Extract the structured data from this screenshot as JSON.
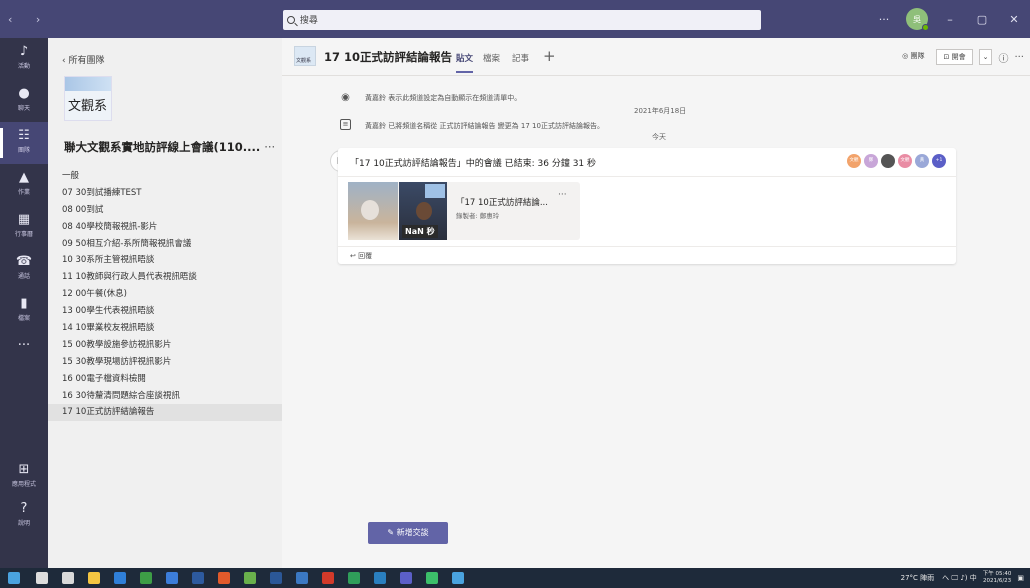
{
  "titlebar": {
    "search_placeholder": "搜尋",
    "more": "···",
    "avatar_initials": "吳"
  },
  "rail": [
    {
      "label": "活動",
      "icon": "bell-icon",
      "glyph": "♪"
    },
    {
      "label": "聊天",
      "icon": "chat-icon",
      "glyph": "●"
    },
    {
      "label": "團隊",
      "icon": "teams-icon",
      "glyph": "☷"
    },
    {
      "label": "作業",
      "icon": "assignments-icon",
      "glyph": "▲"
    },
    {
      "label": "行事曆",
      "icon": "calendar-icon",
      "glyph": "▦"
    },
    {
      "label": "通話",
      "icon": "phone-icon",
      "glyph": "☎"
    },
    {
      "label": "檔案",
      "icon": "files-icon",
      "glyph": "▮"
    },
    {
      "label": "",
      "icon": "more-icon",
      "glyph": "···"
    }
  ],
  "rail_bottom": [
    {
      "label": "應用程式",
      "icon": "apps-icon",
      "glyph": "⊞"
    },
    {
      "label": "說明",
      "icon": "help-icon",
      "glyph": "?"
    }
  ],
  "pane": {
    "back_label": "所有團隊",
    "team_logo_text": "文觀系",
    "team_name": "聯大文觀系實地訪評線上會議(110....",
    "team_more": "···",
    "channels": [
      "一般",
      "07 30到試播練TEST",
      "08 00到試",
      "08 40學校簡報視訊-影片",
      "09 50相互介紹-系所簡報視訊會議",
      "10 30系所主管視訊晤談",
      "11 10教師與行政人員代表視訊晤談",
      "12 00午餐(休息)",
      "13 00學生代表視訊晤談",
      "14 10畢業校友視訊晤談",
      "15 00教學設施參訪視訊影片",
      "15 30教學現場訪評視訊影片",
      "16 00電子檔資料檢閱",
      "16 30待釐清問題綜合座談視訊",
      "17 10正式訪評結論報告"
    ],
    "active_channel": 14
  },
  "main": {
    "channel_icon_text": "文觀系",
    "channel_title": "17 10正式訪評結論報告",
    "tabs": [
      "貼文",
      "檔案",
      "記事"
    ],
    "tab_add": "+",
    "header_buttons": {
      "team_btn": "◎ 團隊",
      "meet_btn": "⊡ 開會",
      "meet_dropdown": "⌄",
      "info": "ⓘ",
      "more": "···"
    },
    "sys_msg_1": "黃嘉鈴 表示此頻道設定為自動顯示在頻道清單中。",
    "date_1": "2021年6月18日",
    "sys_msg_2": "黃嘉鈴 已將頻道名稱從 正式訪評結論報告 變更為 17 10正式訪評結論報告。",
    "date_2": "今天",
    "post": {
      "title": "「17 10正式訪評結論報告」中的會議 已結束: 36 分鐘 31 秒",
      "avatars": [
        {
          "text": "文觀",
          "color": "#f2a36b"
        },
        {
          "text": "鄭",
          "color": "#c8a6d8"
        },
        {
          "text": "",
          "color": "#555555"
        },
        {
          "text": "文觀",
          "color": "#e98ca4"
        },
        {
          "text": "黃",
          "color": "#9aa8d8"
        },
        {
          "text": "+1",
          "color": "#5b5fc7"
        }
      ],
      "meeting_title": "「17 10正式訪評結論...",
      "meeting_sub": "錄製者: 鄭惠玲",
      "meeting_more": "···",
      "duration_overlay": "NaN 秒",
      "reply": "↩ 回覆"
    },
    "new_conversation": "新增交談"
  },
  "taskbar": {
    "tray_weather": "27°C 陣雨",
    "tray_icons": "へ 🖵 ♪) 中",
    "clock_time": "下午 05:40",
    "clock_date": "2021/6/23"
  },
  "colors": {
    "titlebar": "#464775",
    "rail": "#33344a",
    "accent": "#6264a7"
  }
}
